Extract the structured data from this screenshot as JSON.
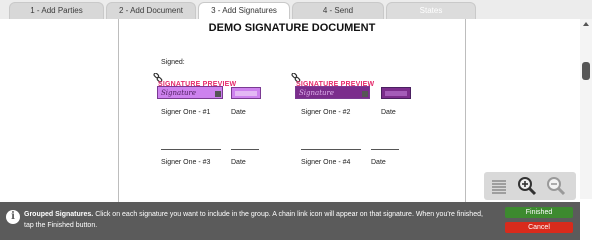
{
  "tabs": [
    {
      "label": "1 - Add Parties"
    },
    {
      "label": "2 - Add Document"
    },
    {
      "label": "3 - Add Signatures"
    },
    {
      "label": "4 - Send"
    },
    {
      "label": "States"
    }
  ],
  "document": {
    "title": "DEMO SIGNATURE DOCUMENT",
    "signed_label": "Signed:",
    "signature_preview_1": "SIGNATURE PREVIEW",
    "signature_preview_2": "SIGNATURE PREVIEW",
    "signature_hand": "Signature",
    "fields": [
      {
        "label": "Signer One - #1"
      },
      {
        "label": "Date"
      },
      {
        "label": "Signer One - #2"
      },
      {
        "label": "Date"
      },
      {
        "label": "Signer One - #3"
      },
      {
        "label": "Date"
      },
      {
        "label": "Signer One - #4"
      },
      {
        "label": "Date"
      }
    ]
  },
  "info": {
    "heading": "Grouped Signatures.",
    "text": "Click on each signature you want to include in the group. A chain link icon will appear on that signature. When you're finished, tap the Finished button."
  },
  "buttons": {
    "finished": "Finished",
    "cancel": "Cancel"
  },
  "icons": {
    "chain": "chain-link-icon",
    "zoom_menu": "lines-icon",
    "zoom_in": "zoom-in-icon",
    "zoom_out": "zoom-out-icon",
    "info": "info-icon"
  },
  "colors": {
    "signature_fill": "#cd82ee",
    "preview_text": "#e52a6b",
    "finished": "#3d8a2f",
    "cancel": "#d82b1c",
    "infobar": "#5b5b5b"
  }
}
